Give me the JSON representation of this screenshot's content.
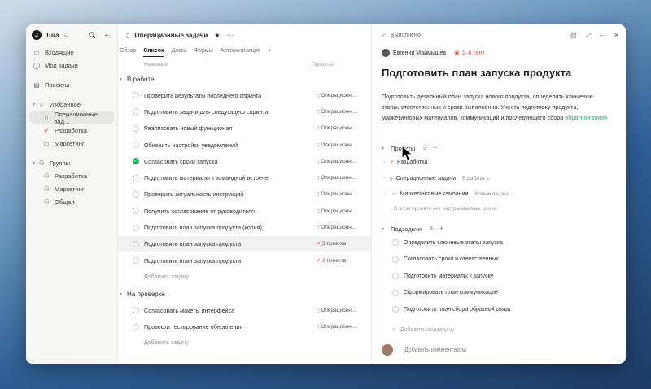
{
  "sidebar": {
    "workspace": "Tura",
    "items": [
      {
        "label": "Входящие",
        "icon": "inbox-icon"
      },
      {
        "label": "Мои задачи",
        "icon": "check-circle-icon"
      }
    ],
    "projects_label": "Проекты",
    "favorites_label": "Избранное",
    "favorites": [
      {
        "label": "Операционные зад...",
        "active": true
      },
      {
        "label": "Разработка"
      },
      {
        "label": "Маркетинг"
      }
    ],
    "groups_label": "Группы",
    "groups": [
      {
        "label": "Разработка"
      },
      {
        "label": "Маркетинг"
      },
      {
        "label": "Общая"
      }
    ]
  },
  "middle": {
    "title": "Операционные задачи",
    "tabs": [
      "Обзор",
      "Список",
      "Доска",
      "Формы",
      "Автоматизация"
    ],
    "active_tab": "Список",
    "col_name": "Название",
    "col_projects": "Проекты",
    "group1": {
      "label": "В работе",
      "rows": [
        {
          "name": "Проверить результаты последнего спринта",
          "project": "Операционн..."
        },
        {
          "name": "Подготовить задачи для следующего спринта",
          "project": "Операционн..."
        },
        {
          "name": "Реализовать новый функционал",
          "project": "Операционн..."
        },
        {
          "name": "Обновить настройки уведомлений",
          "project": "Операционн..."
        },
        {
          "name": "Согласовать сроки запуска",
          "project": "Операционн...",
          "done": true
        },
        {
          "name": "Подготовить материалы к командной встрече",
          "project": "Операционн..."
        },
        {
          "name": "Проверить актуальность инструкций",
          "project": "Операционн..."
        },
        {
          "name": "Получить согласование от руководителя",
          "project": "Операционн..."
        },
        {
          "name": "Подготовить план запуска продукта (копия)",
          "project": "Операционн..."
        },
        {
          "name": "Подготовить план запуска продукта",
          "project": "3 проекта",
          "selected": true
        },
        {
          "name": "Подготовить план запуска продукта",
          "project": "3 проекта"
        }
      ],
      "add": "Добавить задачу"
    },
    "group2": {
      "label": "На проверке",
      "rows": [
        {
          "name": "Согласовать макеты интерфейса",
          "project": "Операционн..."
        },
        {
          "name": "Провести тестирование обновления",
          "project": "Операционн..."
        }
      ],
      "add": "Добавить задачу"
    }
  },
  "detail": {
    "status": "Выполнено",
    "assignee": "Евгений Маймышев",
    "date": "1–6 сент.",
    "title": "Подготовить план запуска продукта",
    "description": "Подготовить детальный план запуска нового продукта, определить ключевые этапы, ответственных и сроки выполнения. Учесть подготовку продукта, маркетинговых материалов, коммуникаций и последующего сбора",
    "description_link": "обратной связи.",
    "projects_label": "Проекты",
    "projects_count": "3",
    "projects": [
      {
        "name": "Разработка",
        "status": ""
      },
      {
        "name": "Операционные задачи",
        "status": "В работе"
      },
      {
        "name": "Маркетинговые кампании",
        "status": "Новые задачи"
      }
    ],
    "no_props": "В этом проекте нет настраиваемых полей",
    "subtasks_label": "Подзадачи",
    "subtasks_count": "5",
    "subtasks": [
      "Определить ключевые этапы запуска",
      "Согласовать сроки и ответственных",
      "Подготовить материалы к запуску",
      "Сформировать план коммуникаций",
      "Подготовить план сбора обратной связи"
    ],
    "add_subtask": "Добавить подзадачу",
    "add_comment": "Добавить комментарий"
  }
}
